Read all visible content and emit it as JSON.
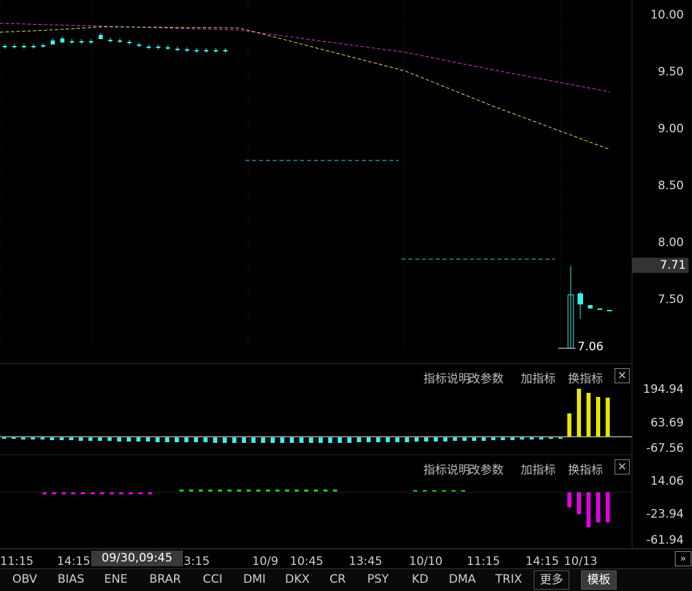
{
  "main_chart": {
    "price_ticks": [
      "10.00",
      "9.50",
      "9.00",
      "8.50",
      "8.00",
      "7.50"
    ],
    "current_price": "7.71",
    "low_marker": "7.06",
    "colors": {
      "candle": "#3af0ee",
      "ma_fast": "#e8e84a",
      "ma_slow": "#d63bd6",
      "level": "#3ad0ee"
    }
  },
  "indicator1": {
    "ticks": [
      "194.94",
      "63.69",
      "-67.56"
    ],
    "toolbar": {
      "explain": "指标说明",
      "params": "改参数",
      "add": "加指标",
      "switch": "换指标"
    }
  },
  "indicator2": {
    "ticks": [
      "14.06",
      "-23.94",
      "-61.94"
    ],
    "toolbar": {
      "explain": "指标说明",
      "params": "改参数",
      "add": "加指标",
      "switch": "换指标"
    }
  },
  "time_axis": {
    "labels": [
      "11:15",
      "14:15",
      "3:15",
      "10/9",
      "10:45",
      "13:45",
      "10/10",
      "11:15",
      "14:15",
      "10/13"
    ],
    "cursor_time": "09/30,09:45"
  },
  "tabs": [
    "OBV",
    "BIAS",
    "ENE",
    "BRAR",
    "CCI",
    "DMI",
    "DKX",
    "CR",
    "PSY",
    "KD",
    "DMA",
    "TRIX"
  ],
  "tab_more": "更多",
  "tab_template": "模板",
  "scroll_icon": "double-chevron-right-icon"
}
